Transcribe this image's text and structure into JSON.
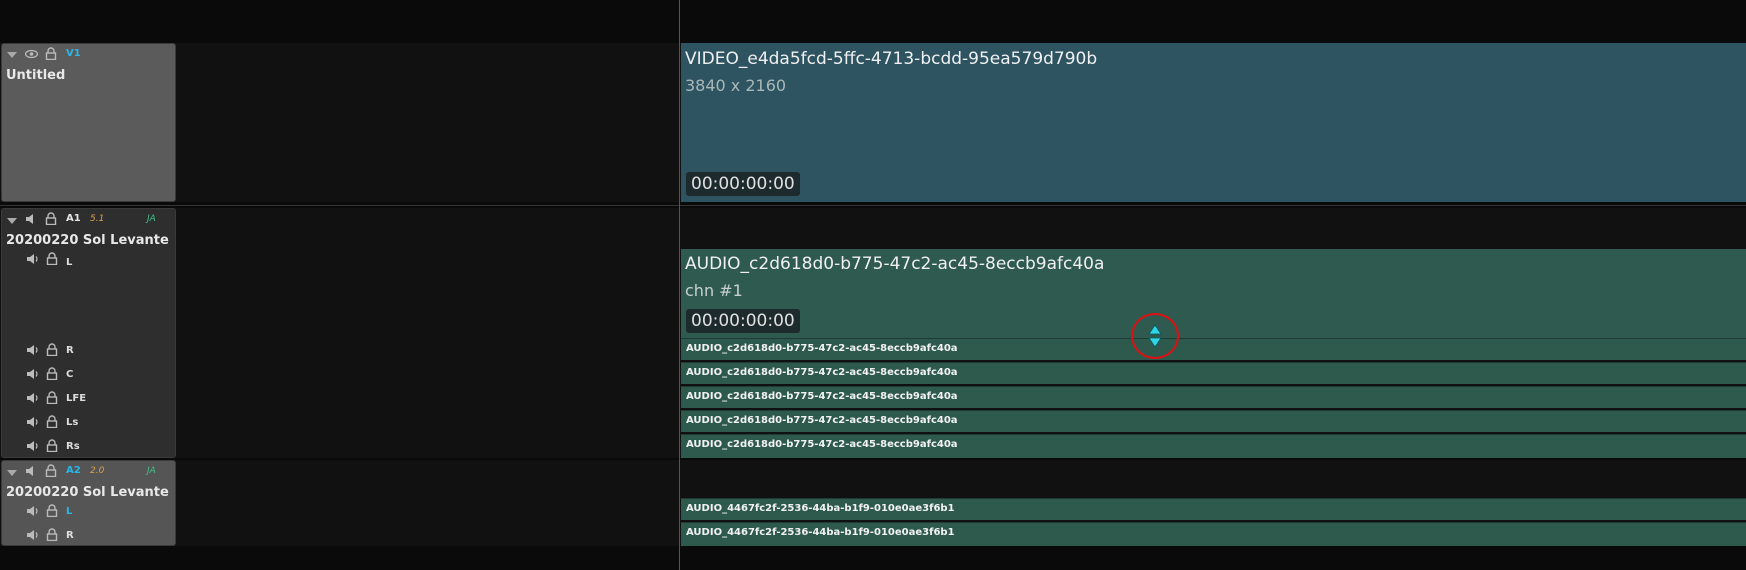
{
  "tracks": {
    "v1": {
      "tag": "V1",
      "name": "Untitled"
    },
    "a1": {
      "tag": "A1",
      "format": "5.1",
      "lang": "JA",
      "name": "20200220 Sol Levante",
      "channels": [
        "L",
        "R",
        "C",
        "LFE",
        "Ls",
        "Rs"
      ]
    },
    "a2": {
      "tag": "A2",
      "format": "2.0",
      "lang": "JA",
      "name": "20200220 Sol Levante",
      "channels": [
        "L",
        "R"
      ]
    }
  },
  "clips": {
    "video": {
      "title": "VIDEO_e4da5fcd-5ffc-4713-bcdd-95ea579d790b",
      "resolution": "3840 x 2160",
      "timecode": "00:00:00:00"
    },
    "audio1": {
      "title": "AUDIO_c2d618d0-b775-47c2-ac45-8eccb9afc40a",
      "channel": "chn #1",
      "timecode": "00:00:00:00",
      "subclips": [
        "AUDIO_c2d618d0-b775-47c2-ac45-8eccb9afc40a",
        "AUDIO_c2d618d0-b775-47c2-ac45-8eccb9afc40a",
        "AUDIO_c2d618d0-b775-47c2-ac45-8eccb9afc40a",
        "AUDIO_c2d618d0-b775-47c2-ac45-8eccb9afc40a",
        "AUDIO_c2d618d0-b775-47c2-ac45-8eccb9afc40a"
      ]
    },
    "audio2": {
      "subclips": [
        "AUDIO_4467fc2f-2536-44ba-b1f9-010e0ae3f6b1",
        "AUDIO_4467fc2f-2536-44ba-b1f9-010e0ae3f6b1"
      ]
    }
  },
  "icons": [
    "expand-triangle-icon",
    "eye-icon",
    "lock-icon",
    "speaker-icon",
    "resize-vertical-icon"
  ],
  "colors": {
    "accent": "#29b6e8",
    "video_clip": "#2e5462",
    "audio_clip": "#2f5a4f",
    "cursor_ring": "#dd1111"
  }
}
